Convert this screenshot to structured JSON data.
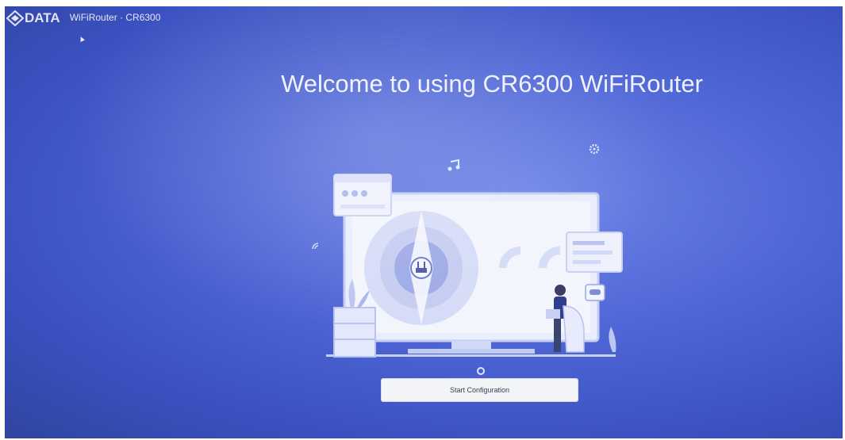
{
  "header": {
    "logo_text": "DATA",
    "product_name": "WiFiRouter · CR6300"
  },
  "welcome": {
    "title": "Welcome to using CR6300 WiFiRouter"
  },
  "actions": {
    "start_label": "Start Configuration"
  },
  "illustration": {
    "icons": [
      "wifi-icon",
      "music-note-icon",
      "gear-icon",
      "router-icon",
      "gamepad-icon",
      "browser-window-icon",
      "chat-bubble-icon",
      "plant-icon",
      "person-icon"
    ]
  },
  "colors": {
    "background": "#4f66d6",
    "background_dark": "#30459f",
    "text": "#eef1fb",
    "button_bg": "#f3f4f8"
  }
}
